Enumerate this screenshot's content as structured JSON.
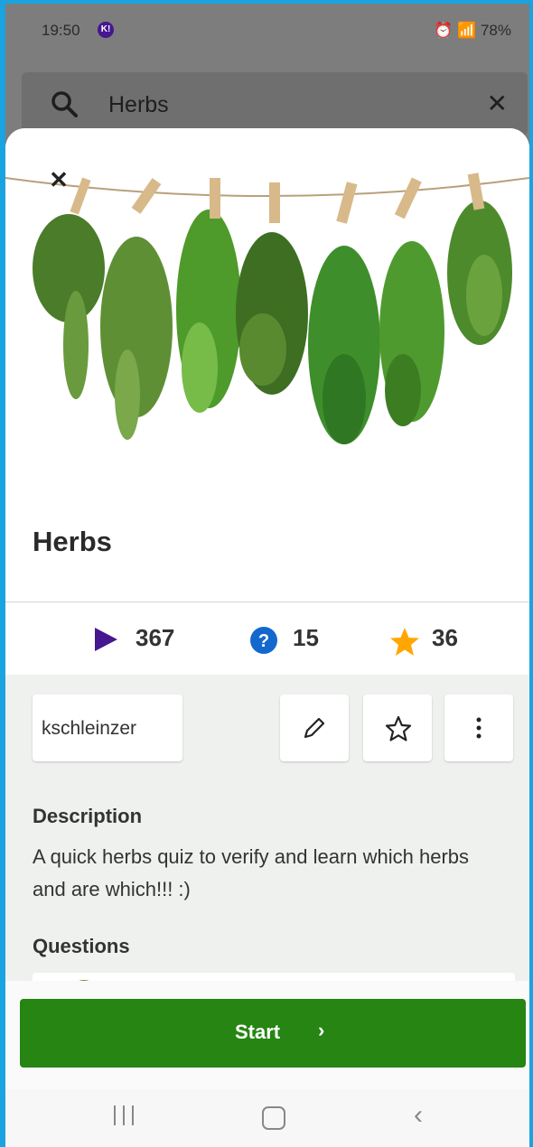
{
  "status_bar": {
    "time": "19:50",
    "app_badge": "K!",
    "battery": "78%"
  },
  "search": {
    "query": "Herbs"
  },
  "kahoot": {
    "title": "Herbs",
    "stats": {
      "plays": "367",
      "questions": "15",
      "favorites": "36"
    },
    "creator": "kschleinzer",
    "description_heading": "Description",
    "description": "A quick herbs quiz to verify and learn which herbs and are which!!! :)",
    "questions_heading": "Questions"
  },
  "start_button": {
    "label": "Start",
    "chevron": "›"
  },
  "icons": {
    "search": "search-icon",
    "clear": "close-icon",
    "close_sheet": "close-icon",
    "plays": "play-icon",
    "questions": "question-mark-icon",
    "favorites": "star-icon",
    "edit": "pencil-icon",
    "favorite": "star-outline-icon",
    "more": "more-vertical-icon"
  },
  "colors": {
    "play_purple": "#46178f",
    "question_blue": "#1368ce",
    "star_orange": "#ffa602",
    "start_green": "#268513",
    "sheet_grey": "#eff1ef",
    "frame_blue": "#1aa3e0"
  }
}
